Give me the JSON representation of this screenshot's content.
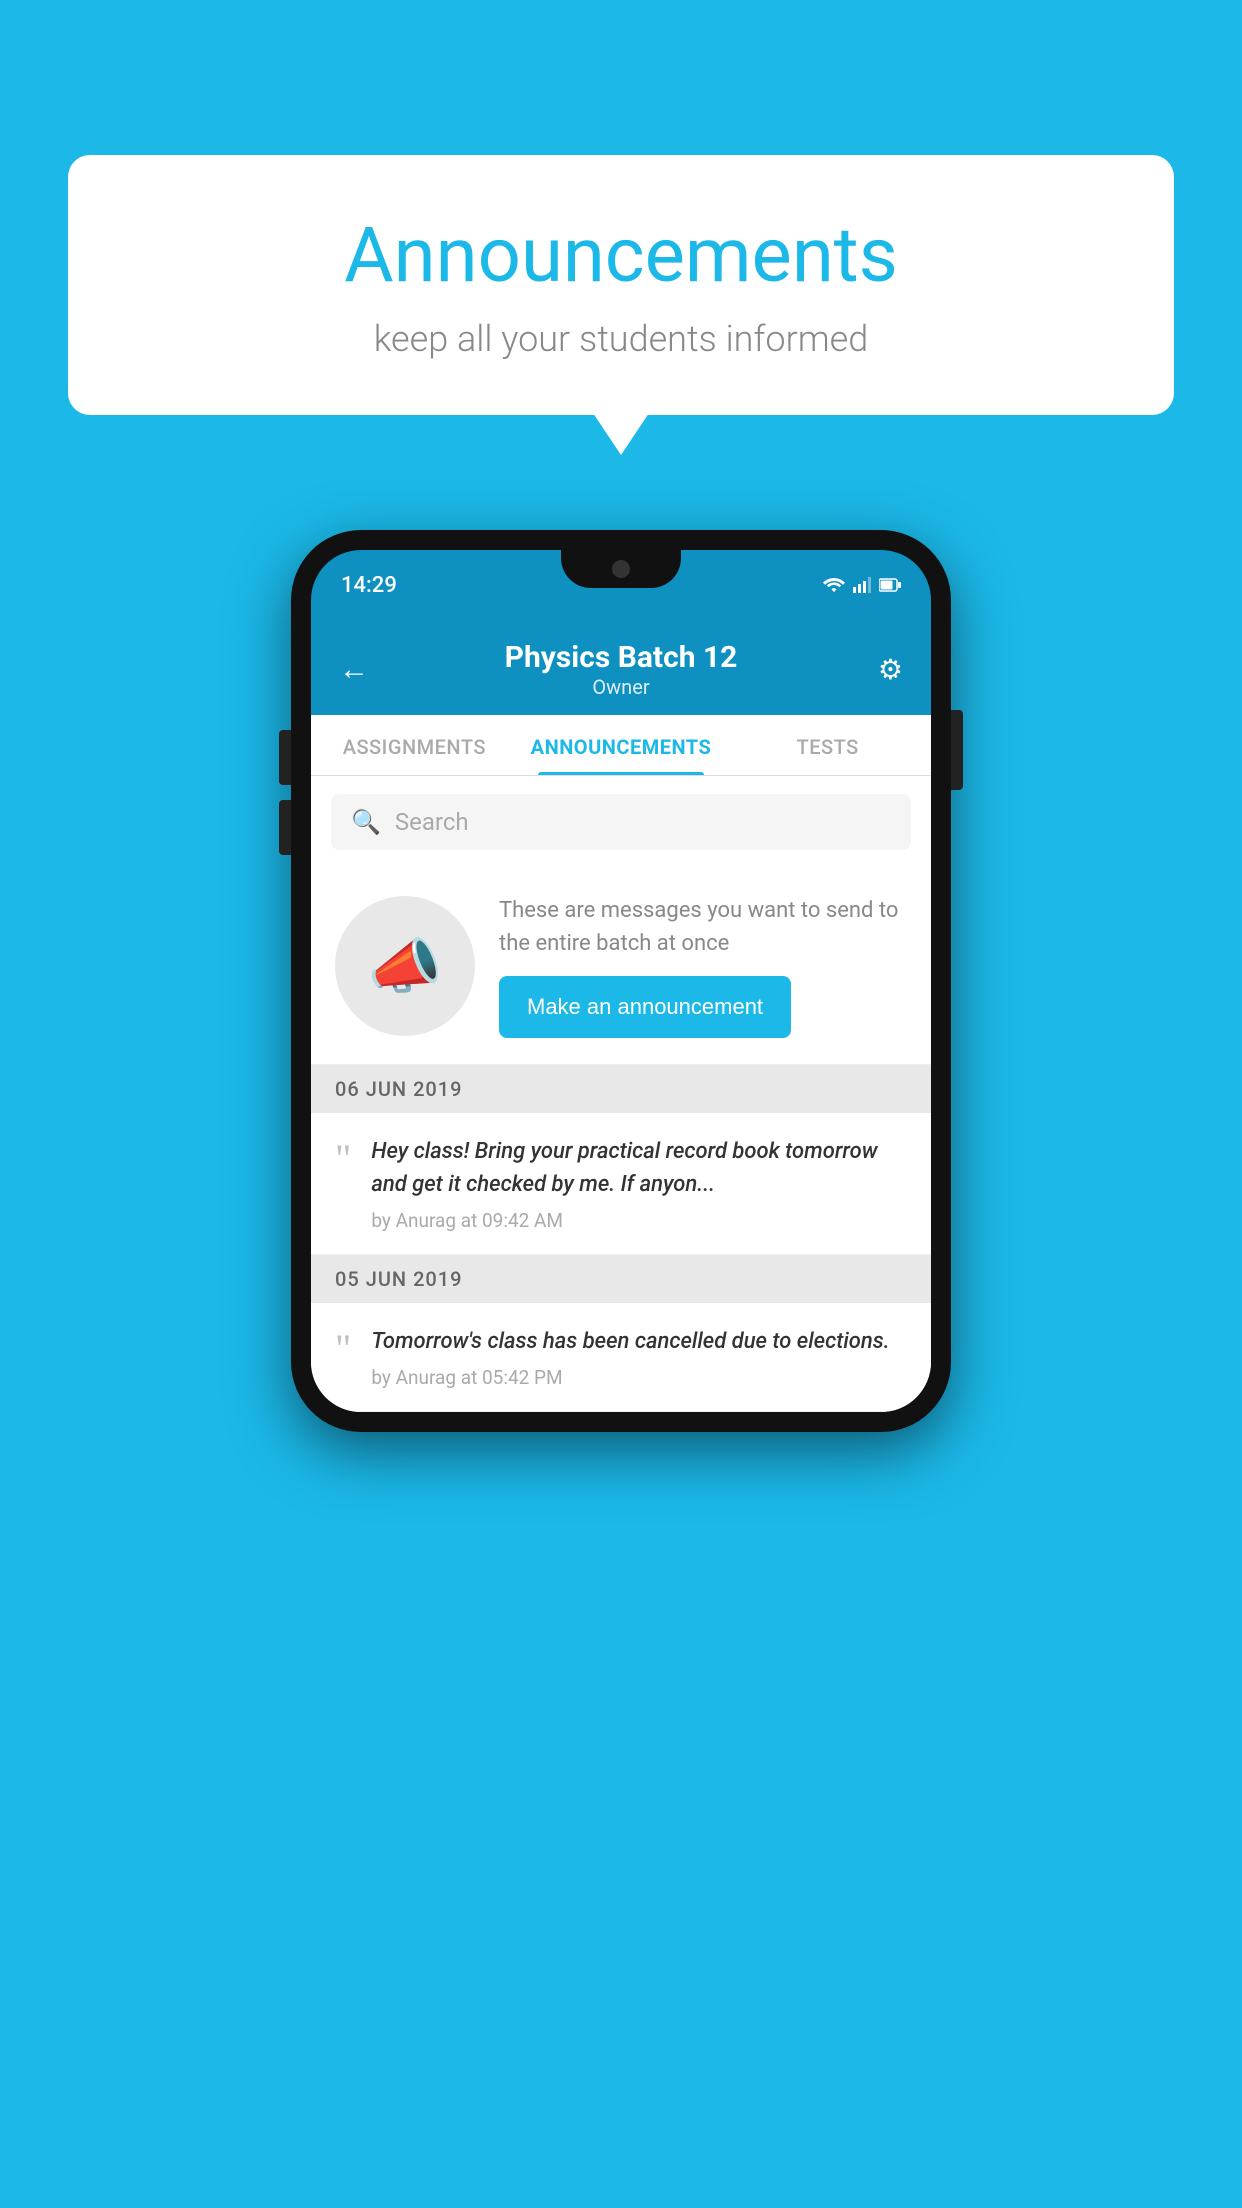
{
  "background_color": "#1bb8e8",
  "bubble": {
    "title": "Announcements",
    "subtitle": "keep all your students informed"
  },
  "phone": {
    "status_bar": {
      "time": "14:29"
    },
    "header": {
      "title": "Physics Batch 12",
      "subtitle": "Owner",
      "back_label": "←"
    },
    "tabs": [
      {
        "label": "ASSIGNMENTS",
        "active": false
      },
      {
        "label": "ANNOUNCEMENTS",
        "active": true
      },
      {
        "label": "TESTS",
        "active": false
      }
    ],
    "search": {
      "placeholder": "Search"
    },
    "promo": {
      "description": "These are messages you want to send to the entire batch at once",
      "button_label": "Make an announcement"
    },
    "announcements": [
      {
        "date": "06  JUN  2019",
        "text": "Hey class! Bring your practical record book tomorrow and get it checked by me. If anyon...",
        "meta": "by Anurag at 09:42 AM"
      },
      {
        "date": "05  JUN  2019",
        "text": "Tomorrow's class has been cancelled due to elections.",
        "meta": "by Anurag at 05:42 PM"
      }
    ]
  }
}
